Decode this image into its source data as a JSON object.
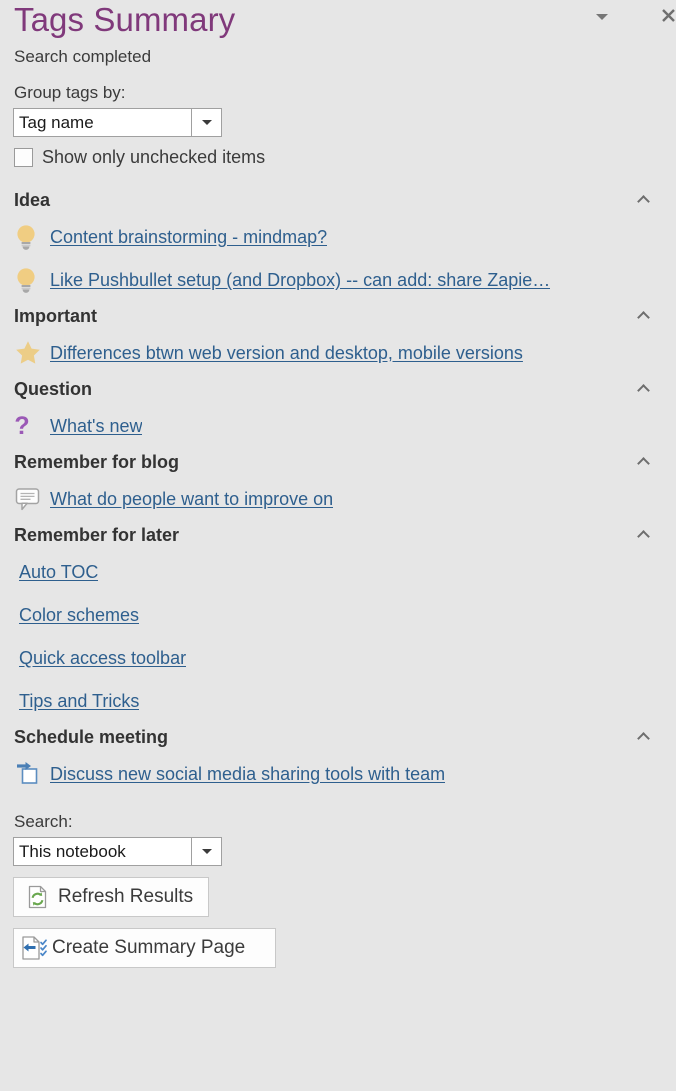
{
  "pane": {
    "title": "Tags Summary",
    "status": "Search completed",
    "dropdown_icon": "caret-down-icon",
    "close_icon": "close-icon"
  },
  "controls": {
    "group_by_label": "Group tags by:",
    "group_by_value": "Tag name",
    "group_by_placeholder": "Tag name",
    "show_unchecked_label": "Show only unchecked items",
    "show_unchecked_checked": false,
    "collapse_icon": "chevron-up-icon"
  },
  "groups": [
    {
      "title": "Idea",
      "icon": "lightbulb-icon",
      "items": [
        {
          "label": "Content brainstorming - mindmap?"
        },
        {
          "label": "Like Pushbullet setup (and Dropbox) -- can add: share Zapie…"
        }
      ]
    },
    {
      "title": "Important",
      "icon": "star-icon",
      "items": [
        {
          "label": "Differences btwn web version and desktop, mobile versions"
        }
      ]
    },
    {
      "title": "Question",
      "icon": "question-mark-icon",
      "items": [
        {
          "label": "What's new"
        }
      ]
    },
    {
      "title": "Remember for blog",
      "icon": "comment-bubble-icon",
      "items": [
        {
          "label": "What do people want to improve on"
        }
      ]
    },
    {
      "title": "Remember for later",
      "icon": "none",
      "items": [
        {
          "label": "Auto TOC"
        },
        {
          "label": "Color schemes"
        },
        {
          "label": "Quick access toolbar"
        },
        {
          "label": "Tips and Tricks"
        }
      ]
    },
    {
      "title": "Schedule meeting",
      "icon": "schedule-meeting-icon",
      "items": [
        {
          "label": "Discuss new social media sharing tools with team"
        }
      ]
    }
  ],
  "footer": {
    "search_label": "Search:",
    "search_scope_value": "This notebook",
    "search_scope_placeholder": "This notebook",
    "refresh_label": "Refresh Results",
    "refresh_icon": "refresh-page-icon",
    "summary_label": "Create Summary Page",
    "summary_icon": "create-summary-page-icon"
  },
  "colors": {
    "background": "#e6e6e6",
    "title": "#80397b",
    "link": "#2e5f8e",
    "heading": "#333333",
    "bulb": "#f0cd82",
    "star": "#eccd87",
    "question": "#9b59b6",
    "schedule_blue": "#5b8dc0",
    "refresh_green": "#6aa84f"
  }
}
